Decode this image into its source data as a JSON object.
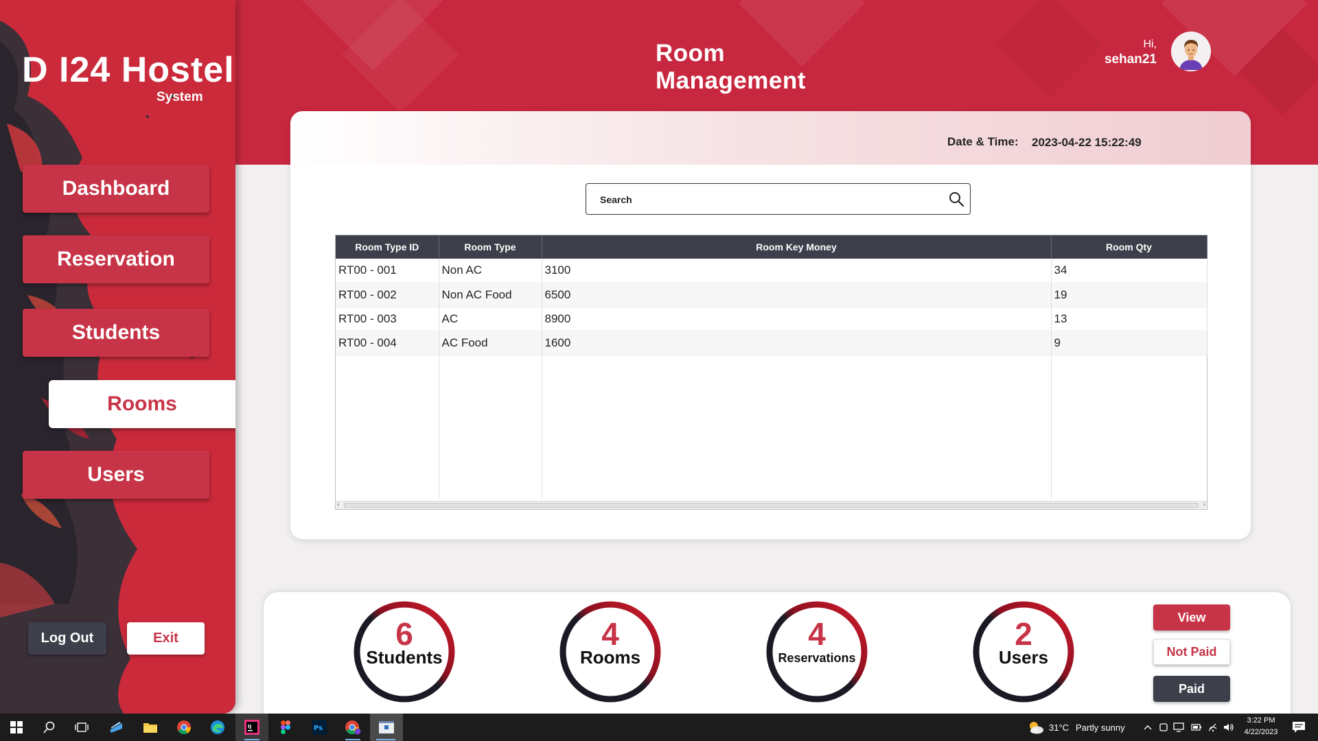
{
  "header": {
    "title": "Room Management",
    "greeting": "Hi,",
    "username": "sehan21"
  },
  "sidebar": {
    "logo": "D I24 Hostel",
    "logo_sub": "System",
    "items": [
      {
        "label": "Dashboard",
        "active": false
      },
      {
        "label": "Reservation",
        "active": false
      },
      {
        "label": "Students",
        "active": false
      },
      {
        "label": "Rooms",
        "active": true
      },
      {
        "label": "Users",
        "active": false
      }
    ],
    "logout_label": "Log Out",
    "exit_label": "Exit"
  },
  "main": {
    "datetime_label": "Date & Time:",
    "datetime_value": "2023-04-22 15:22:49",
    "search_placeholder": "Search",
    "table": {
      "columns": [
        "Room Type ID",
        "Room Type",
        "Room Key Money",
        "Room Qty"
      ],
      "rows": [
        [
          "RT00 - 001",
          "Non AC",
          "3100",
          "34"
        ],
        [
          "RT00 - 002",
          "Non AC Food",
          "6500",
          "19"
        ],
        [
          "RT00 - 003",
          "AC",
          "8900",
          "13"
        ],
        [
          "RT00 - 004",
          "AC Food",
          "1600",
          "9"
        ]
      ]
    }
  },
  "stats": {
    "items": [
      {
        "value": "6",
        "label": "Students"
      },
      {
        "value": "4",
        "label": "Rooms"
      },
      {
        "value": "4",
        "label": "Reservations"
      },
      {
        "value": "2",
        "label": "Users"
      }
    ],
    "view_label": "View",
    "not_paid_label": "Not Paid",
    "paid_label": "Paid"
  },
  "taskbar": {
    "weather_temp": "31°C",
    "weather_desc": "Partly sunny",
    "time": "3:22 PM",
    "date": "4/22/2023"
  },
  "colors": {
    "brand_red": "#c8283f",
    "button_red": "#c73447",
    "dark": "#3d3f4a"
  }
}
